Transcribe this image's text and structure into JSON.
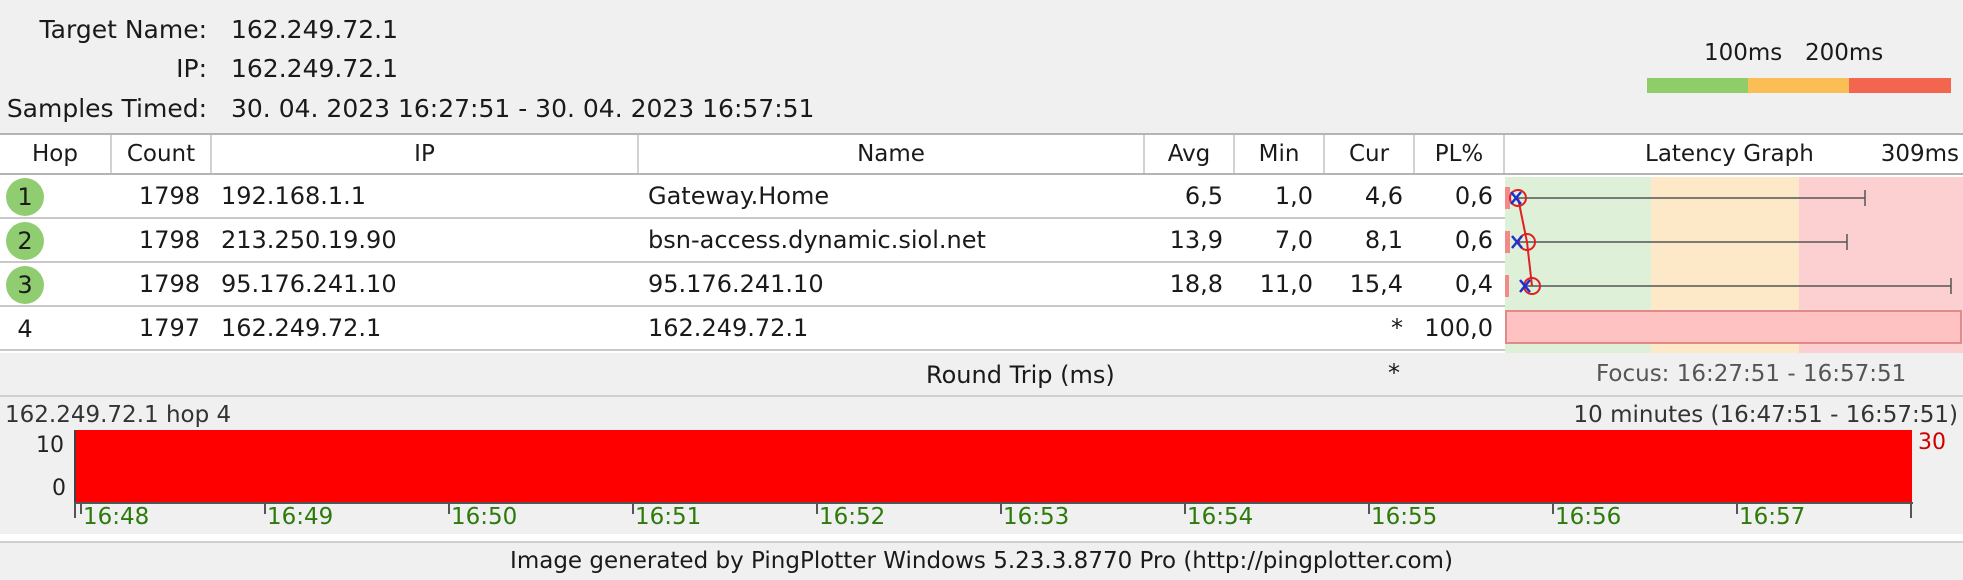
{
  "target": {
    "name_label": "Target Name:",
    "name": "162.249.72.1",
    "ip_label": "IP:",
    "ip": "162.249.72.1",
    "samples_label": "Samples Timed:",
    "samples": "30. 04. 2023 16:27:51 - 30. 04. 2023 16:57:51"
  },
  "scale": {
    "label_100": "100ms",
    "label_200": "200ms",
    "colors": {
      "good": "#8fcd6a",
      "warn": "#fbbe54",
      "bad": "#f2654f"
    }
  },
  "table": {
    "headers": {
      "hop": "Hop",
      "count": "Count",
      "ip": "IP",
      "name": "Name",
      "avg": "Avg",
      "min": "Min",
      "cur": "Cur",
      "pl": "PL%",
      "graph": "Latency Graph",
      "graph_max": "309ms"
    },
    "rows": [
      {
        "hop": "1",
        "count": "1798",
        "ip": "192.168.1.1",
        "name": "Gateway.Home",
        "avg": "6,5",
        "min": "1,0",
        "cur": "4,6",
        "pl": "0,6"
      },
      {
        "hop": "2",
        "count": "1798",
        "ip": "213.250.19.90",
        "name": "bsn-access.dynamic.siol.net",
        "avg": "13,9",
        "min": "7,0",
        "cur": "8,1",
        "pl": "0,6"
      },
      {
        "hop": "3",
        "count": "1798",
        "ip": "95.176.241.10",
        "name": "95.176.241.10",
        "avg": "18,8",
        "min": "11,0",
        "cur": "15,4",
        "pl": "0,4"
      },
      {
        "hop": "4",
        "count": "1797",
        "ip": "162.249.72.1",
        "name": "162.249.72.1",
        "avg": "",
        "min": "",
        "cur": "*",
        "pl": "100,0"
      }
    ],
    "round_trip_label": "Round Trip (ms)",
    "round_trip_cur": "*",
    "focus": "Focus: 16:27:51 - 16:57:51"
  },
  "timeline": {
    "title": "162.249.72.1 hop 4",
    "range": "10 minutes (16:47:51 - 16:57:51)",
    "y_top": "10",
    "y_bottom": "0",
    "y_max_label": "30",
    "times": [
      "16:48",
      "16:49",
      "16:50",
      "16:51",
      "16:52",
      "16:53",
      "16:54",
      "16:55",
      "16:56",
      "16:57"
    ]
  },
  "footer": "Image generated by PingPlotter Windows 5.23.3.8770 Pro (http://pingplotter.com)"
}
